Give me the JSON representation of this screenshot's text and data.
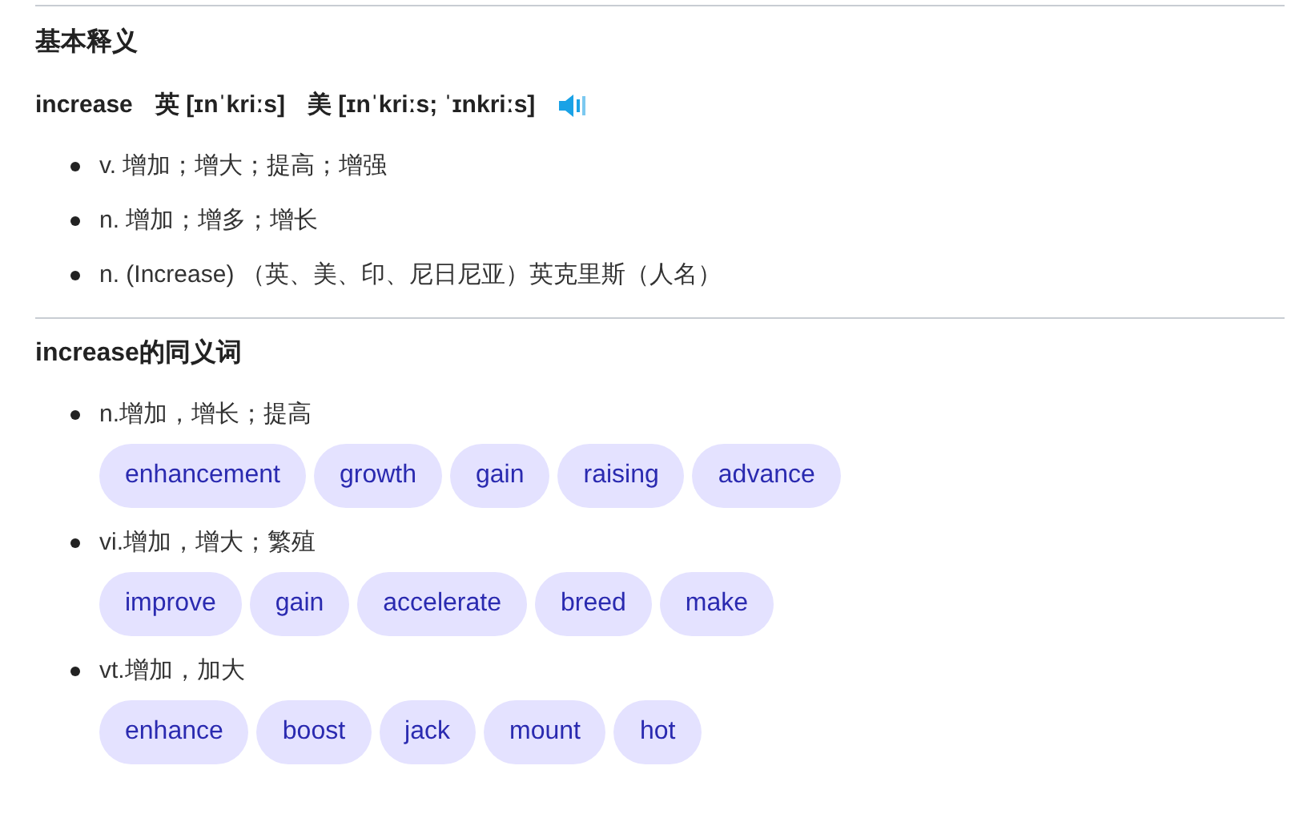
{
  "basic": {
    "title": "基本释义",
    "headword": {
      "word": "increase",
      "uk_label": "英",
      "uk_phonetic": "[ɪnˈkriːs]",
      "us_label": "美",
      "us_phonetic": "[ɪnˈkriːs; ˈɪnkriːs]"
    },
    "senses": [
      "v. 增加；增大；提高；增强",
      "n. 增加；增多；增长",
      "n. (Increase) （英、美、印、尼日尼亚）英克里斯（人名）"
    ]
  },
  "synonyms": {
    "title": "increase的同义词",
    "groups": [
      {
        "sense": "n.增加，增长；提高",
        "words": [
          "enhancement",
          "growth",
          "gain",
          "raising",
          "advance"
        ]
      },
      {
        "sense": "vi.增加，增大；繁殖",
        "words": [
          "improve",
          "gain",
          "accelerate",
          "breed",
          "make"
        ]
      },
      {
        "sense": "vt.增加，加大",
        "words": [
          "enhance",
          "boost",
          "jack",
          "mount",
          "hot"
        ]
      }
    ]
  }
}
